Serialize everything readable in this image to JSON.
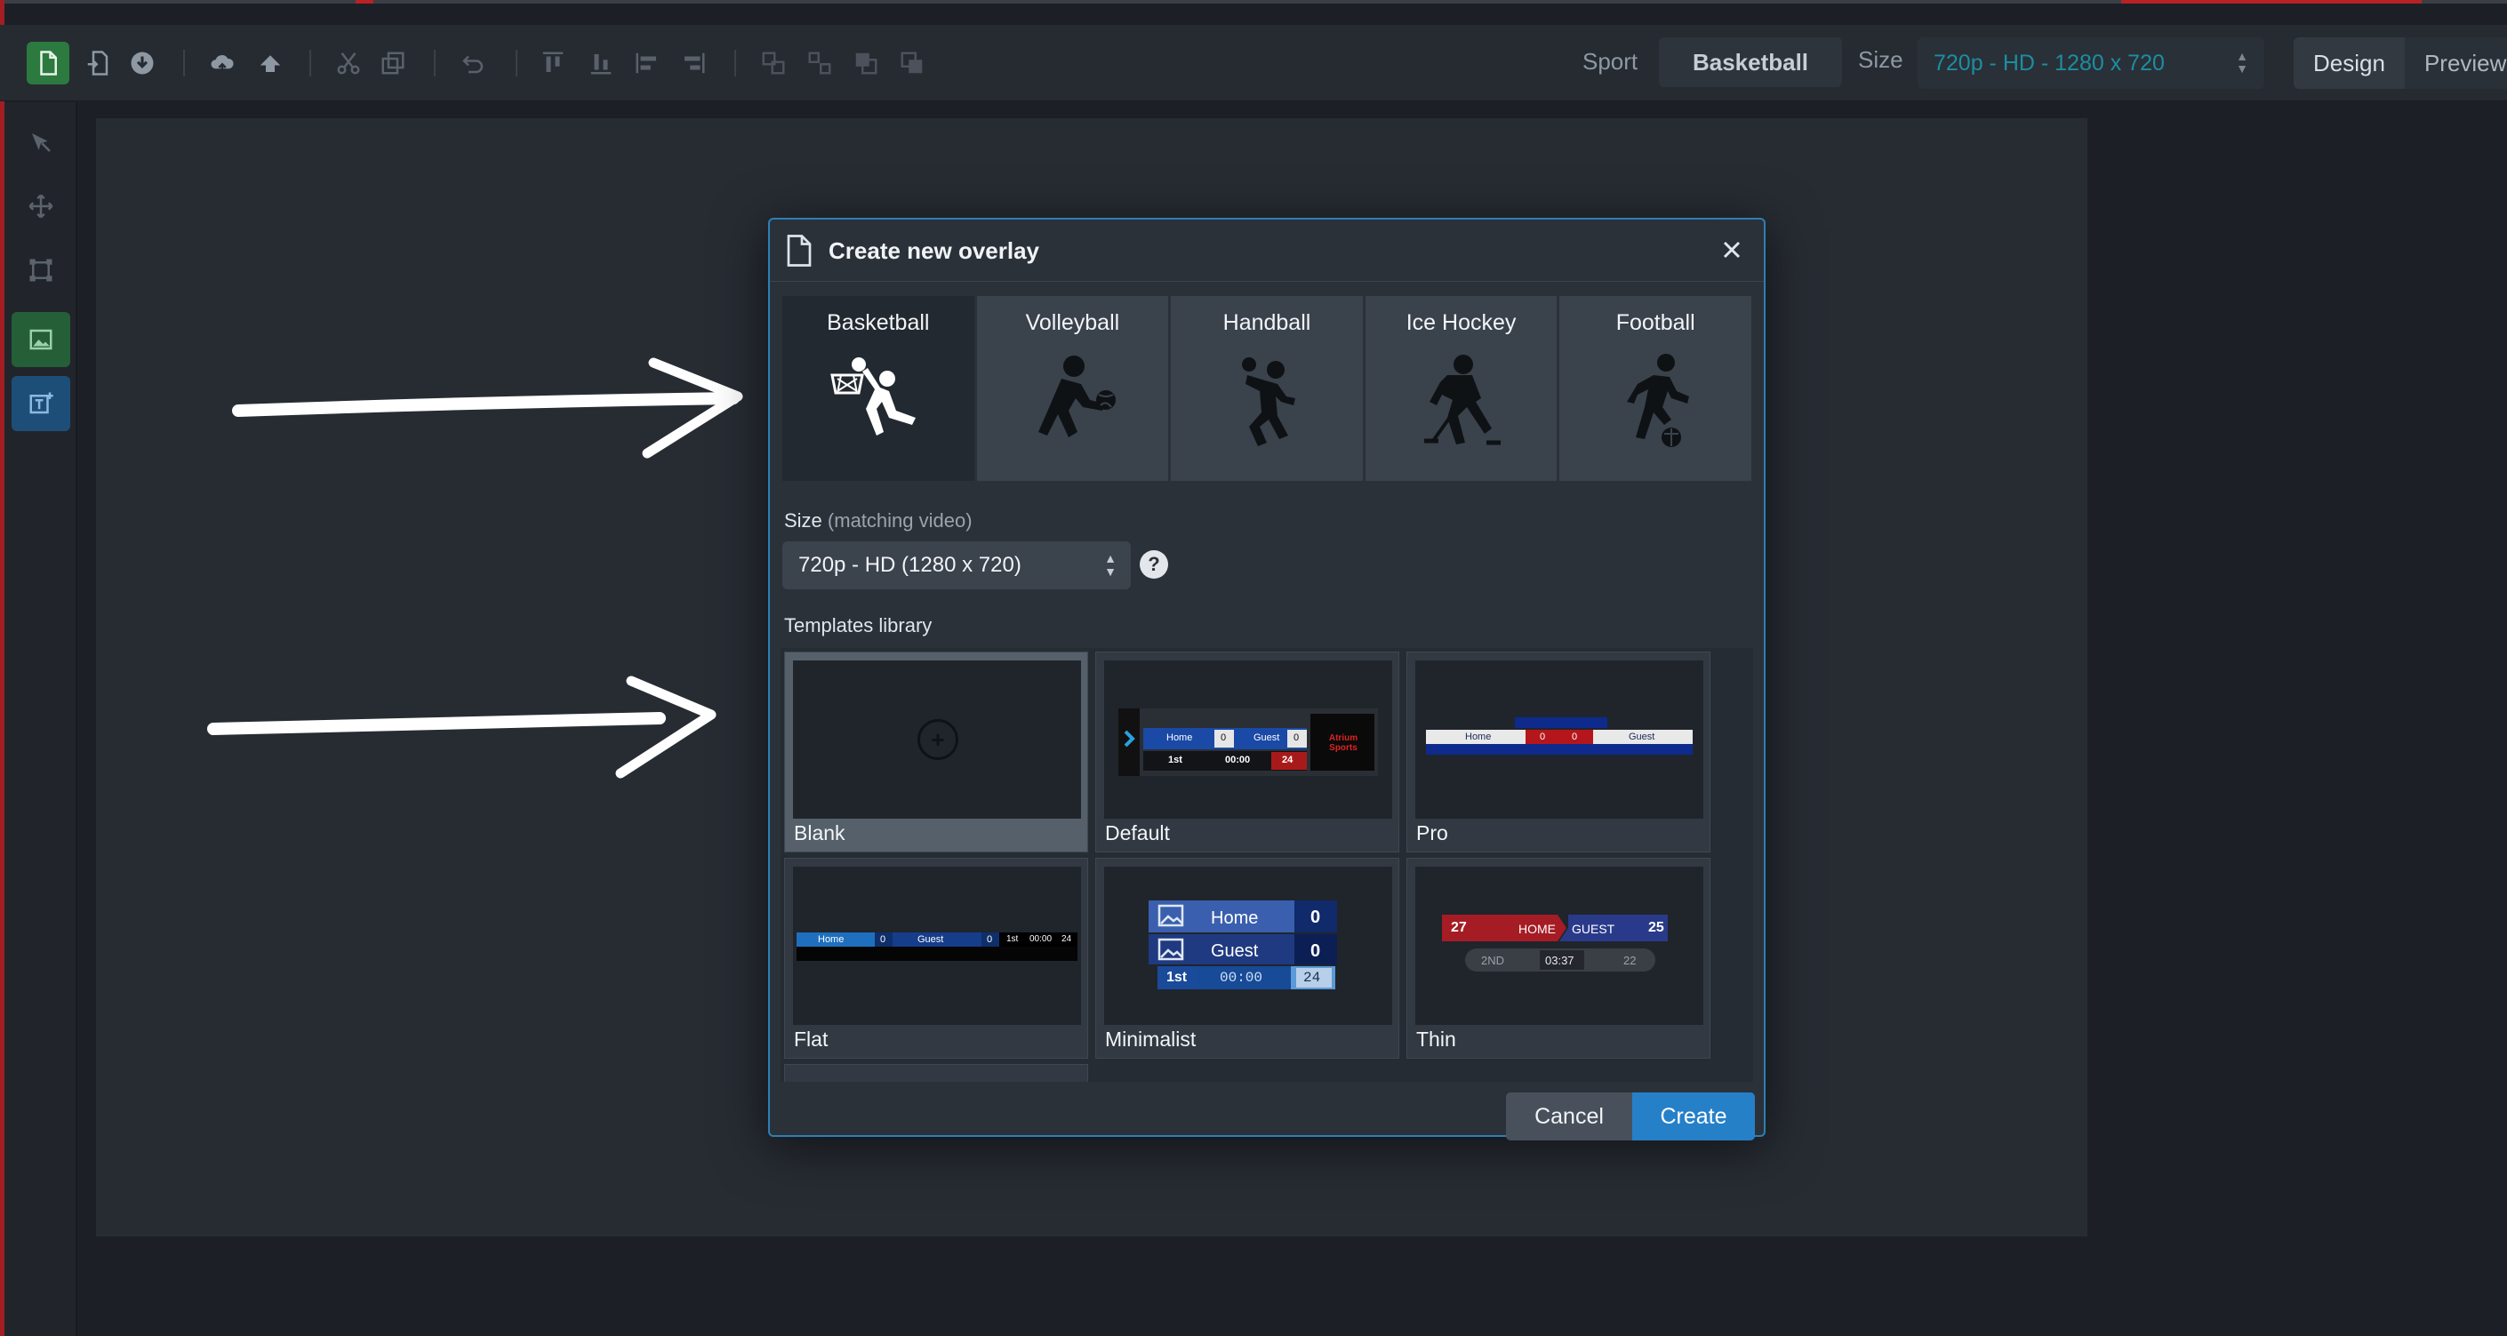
{
  "toolbar": {
    "sport_label": "Sport",
    "sport_value": "Basketball",
    "size_label": "Size",
    "size_value": "720p - HD - 1280 x 720",
    "mode_tabs": [
      "Design",
      "Preview"
    ]
  },
  "dialog": {
    "title": "Create new overlay",
    "sports": [
      "Basketball",
      "Volleyball",
      "Handball",
      "Ice Hockey",
      "Football"
    ],
    "selected_sport": "Basketball",
    "size_label": "Size",
    "size_hint": "(matching video)",
    "size_value": "720p - HD (1280 x 720)",
    "help_glyph": "?",
    "library_label": "Templates library",
    "templates": [
      "Blank",
      "Default",
      "Pro",
      "Flat",
      "Minimalist",
      "Thin"
    ],
    "selected_template": "Blank",
    "cancel_label": "Cancel",
    "create_label": "Create"
  },
  "thumbs": {
    "default": {
      "home": "Home",
      "home_score": "0",
      "guest": "Guest",
      "guest_score": "0",
      "period": "1st",
      "clock": "00:00",
      "shot": "24",
      "brand": "Atrium Sports"
    },
    "pro": {
      "home": "Home",
      "home_score": "0",
      "guest_score": "0",
      "guest": "Guest"
    },
    "flat": {
      "home": "Home",
      "home_score": "0",
      "guest": "Guest",
      "guest_score": "0",
      "period": "1st",
      "clock": "00:00",
      "shot": "24"
    },
    "minimalist": {
      "home": "Home",
      "home_score": "0",
      "guest": "Guest",
      "guest_score": "0",
      "period": "1st",
      "clock": "00:00",
      "shot": "24"
    },
    "thin": {
      "home_score": "27",
      "home": "HOME",
      "guest": "GUEST",
      "guest_score": "25",
      "period": "2ND",
      "clock": "03:37",
      "shot": "22"
    }
  },
  "colors": {
    "accent": "#2680c8",
    "sport_green": "#2c7a3f",
    "dialog_border": "#2d7fb5"
  }
}
